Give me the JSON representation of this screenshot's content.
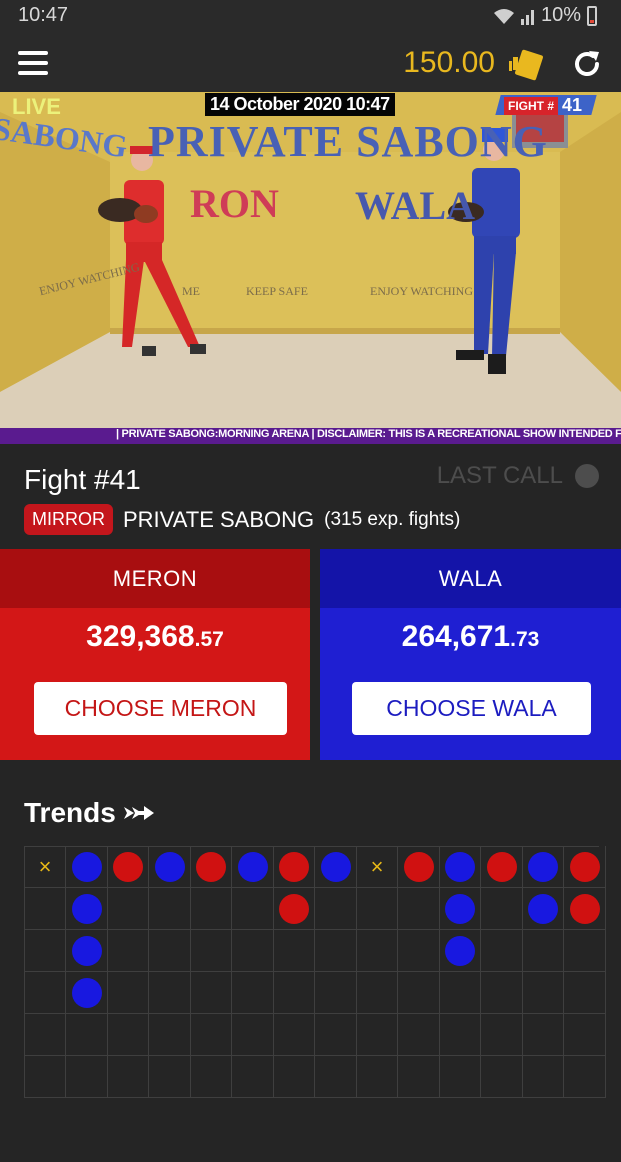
{
  "status_bar": {
    "time": "10:47",
    "battery": "10%"
  },
  "app_bar": {
    "balance": "150.00"
  },
  "video": {
    "live": "LIVE",
    "date": "14 October 2020 10:47",
    "fight_label": "FIGHT #",
    "fight_no": "41",
    "arena_title": "PRIVATE SABONG",
    "left_wall": "SABONG",
    "meron_sign": "RON",
    "wala_sign": "WALA",
    "enjoy_left": "ENJOY WATCHING",
    "welcome": "ME",
    "keep_safe": "KEEP SAFE",
    "enjoy_right": "ENJOY WATCHING",
    "ticker": "| PRIVATE SABONG:MORNING ARENA | DISCLAIMER: THIS IS A RECREATIONAL SHOW INTENDED FOR PRIVATE VIEWING / ENTERTAINMENT"
  },
  "fight": {
    "title": "Fight #41",
    "last_call": "LAST CALL",
    "mirror_badge": "MIRROR",
    "source": "PRIVATE SABONG",
    "source_count": "(315 exp. fights)"
  },
  "meron": {
    "label": "MERON",
    "amount_int": "329,368",
    "amount_dec": ".57",
    "button": "CHOOSE MERON"
  },
  "wala": {
    "label": "WALA",
    "amount_int": "264,671",
    "amount_dec": ".73",
    "button": "CHOOSE WALA"
  },
  "trends": {
    "title": "Trends",
    "columns": [
      [
        "cancel"
      ],
      [
        "wala",
        "wala",
        "wala",
        "wala"
      ],
      [
        "meron"
      ],
      [
        "wala"
      ],
      [
        "meron"
      ],
      [
        "wala"
      ],
      [
        "meron",
        "meron"
      ],
      [
        "wala"
      ],
      [
        "cancel"
      ],
      [
        "meron"
      ],
      [
        "wala",
        "wala",
        "wala"
      ],
      [
        "meron"
      ],
      [
        "wala",
        "wala"
      ],
      [
        "meron",
        "meron"
      ]
    ],
    "cancel_symbol": "×",
    "colors": {
      "meron": "#d01111",
      "wala": "#1818e0",
      "cancel": "#e7b817"
    }
  }
}
